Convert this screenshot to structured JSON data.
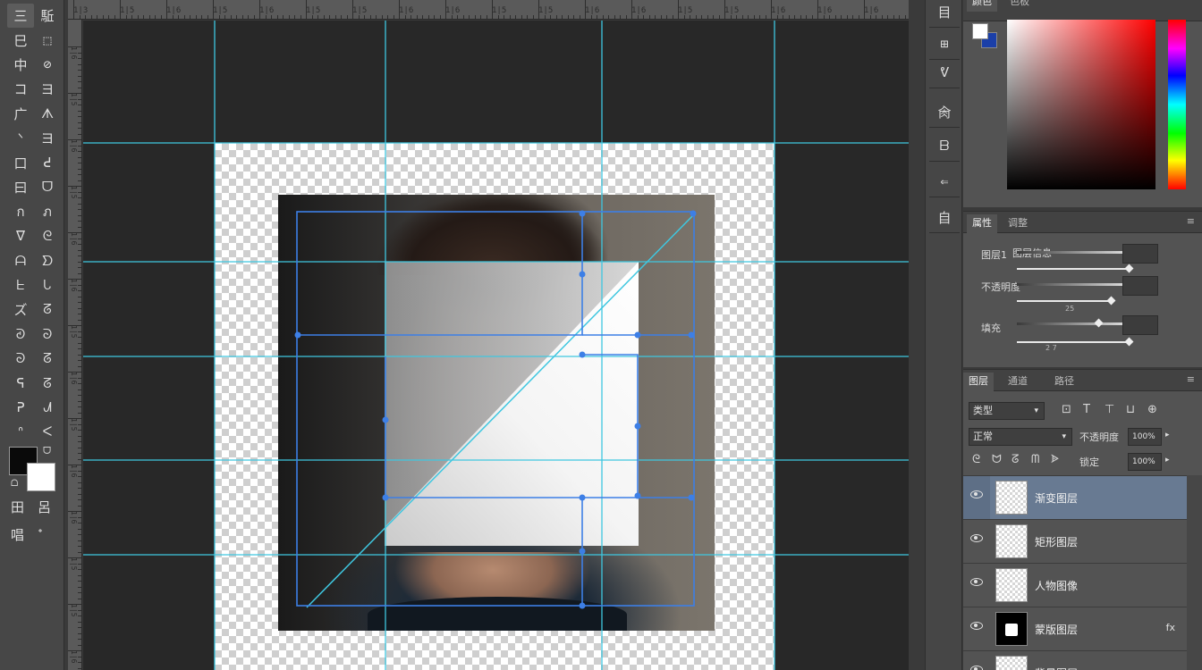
{
  "toolbar": {
    "tools": [
      {
        "glyph": "三",
        "icon": "move-icon"
      },
      {
        "glyph": "駈",
        "icon": "artboard-icon"
      },
      {
        "glyph": "巳",
        "icon": "marquee-icon"
      },
      {
        "glyph": "⬚",
        "icon": "lasso-icon"
      },
      {
        "glyph": "中",
        "icon": "quick-select-icon"
      },
      {
        "glyph": "⊘",
        "icon": "magic-wand-icon"
      },
      {
        "glyph": "コ",
        "icon": "crop-icon"
      },
      {
        "glyph": "ヨ",
        "icon": "slice-icon"
      },
      {
        "glyph": "广",
        "icon": "eyedropper-icon"
      },
      {
        "glyph": "ᗑ",
        "icon": "ruler-icon"
      },
      {
        "glyph": "ᐠ",
        "icon": "healing-icon"
      },
      {
        "glyph": "ヨ",
        "icon": "patch-icon"
      },
      {
        "glyph": "口",
        "icon": "brush-icon"
      },
      {
        "glyph": "ᕍ",
        "icon": "pencil-icon"
      },
      {
        "glyph": "曰",
        "icon": "stamp-icon"
      },
      {
        "glyph": "ᗜ",
        "icon": "pattern-stamp-icon"
      },
      {
        "glyph": "ก",
        "icon": "history-brush-icon"
      },
      {
        "glyph": "ภ",
        "icon": "art-history-icon"
      },
      {
        "glyph": "ᐁ",
        "icon": "eraser-icon"
      },
      {
        "glyph": "ᘓ",
        "icon": "bg-eraser-icon"
      },
      {
        "glyph": "ᗩ",
        "icon": "gradient-icon"
      },
      {
        "glyph": "ᗤ",
        "icon": "paint-bucket-icon"
      },
      {
        "glyph": "ᖶ",
        "icon": "blur-icon"
      },
      {
        "glyph": "ᘂ",
        "icon": "sharpen-icon"
      },
      {
        "glyph": "ズ",
        "icon": "dodge-icon"
      },
      {
        "glyph": "ᘔ",
        "icon": "burn-icon"
      },
      {
        "glyph": "ᘑ",
        "icon": "pen-icon"
      },
      {
        "glyph": "ᘐ",
        "icon": "freeform-pen-icon"
      },
      {
        "glyph": "ᘐ",
        "icon": "type-icon"
      },
      {
        "glyph": "ᘔ",
        "icon": "vertical-type-icon"
      },
      {
        "glyph": "ᕋ",
        "icon": "path-select-icon"
      },
      {
        "glyph": "ᘔ",
        "icon": "direct-select-icon"
      },
      {
        "glyph": "ᕈ",
        "icon": "rectangle-icon"
      },
      {
        "glyph": "ᗂ",
        "icon": "ellipse-icon"
      },
      {
        "glyph": "ᐢ",
        "icon": "hand-icon"
      },
      {
        "glyph": "ᐸ",
        "icon": "zoom-icon"
      }
    ],
    "swap_glyph": "ᗜ",
    "reset_glyph": "ᗝ",
    "quickmask_a": "田",
    "quickmask_b": "呂",
    "screen_mode_a": "唱",
    "screen_mode_b": "ᐩ",
    "fg_color": "#0a0a0a",
    "bg_color": "#ffffff"
  },
  "rulers": {
    "top_labels": [
      "1|3",
      "1|5",
      "1|6",
      "1|5",
      "1|6",
      "1|5",
      "1|5",
      "1|6",
      "1|6",
      "1|5",
      "1|5",
      "1|6",
      "1|6",
      "1|5",
      "1|5",
      "1|6",
      "1|6",
      "1|6"
    ],
    "left_labels": [
      "1|6",
      "1|5",
      "1|6",
      "1|5",
      "1|6",
      "1|6",
      "1|5",
      "1|6",
      "1|5",
      "1|6",
      "1|6",
      "1|5",
      "1|5",
      "1|6"
    ]
  },
  "middle_column": {
    "icons": [
      "history-icon",
      "actions-icon",
      "brush-presets-icon",
      "swatches-icon",
      "properties-icon",
      "paths-icon",
      "libraries-icon"
    ],
    "glyphs": [
      "目",
      "⊞",
      "ᕓ",
      "肏",
      "ᗷ",
      "⇐",
      "自"
    ]
  },
  "color_panel": {
    "tabs": [
      "颜色",
      "色板"
    ],
    "fg_color": "#ffffff",
    "bg_color": "#1b3fa8"
  },
  "adjust_panel": {
    "tabs": [
      "属性",
      "调整"
    ],
    "rows": [
      {
        "label": "图层1",
        "label2": "图层信息",
        "small": ""
      },
      {
        "label": "不透明度",
        "label2": "",
        "small": "25"
      },
      {
        "label": "填充",
        "label2": "",
        "small": "2   7"
      }
    ],
    "close_glyph": "≡"
  },
  "layers_panel": {
    "tabs": [
      "图层",
      "通道",
      "路径"
    ],
    "filter_kind": "类型",
    "filter_icons": [
      "⊡",
      "T",
      "⊤",
      "⊔",
      "⊕"
    ],
    "blend_mode": "正常",
    "opacity_label": "不透明度",
    "opacity_value": "100%",
    "lock_label": "锁定",
    "lock_icons": [
      "ᘓ",
      "ᗢ",
      "ᘔ",
      "ᗰ",
      "ᗎ"
    ],
    "fill_label": "填充",
    "fill_value": "100%",
    "close_glyph": "≡",
    "layers": [
      {
        "name": "渐变图层",
        "fx": "",
        "thumb": "transparent",
        "selected": true
      },
      {
        "name": "矩形图层",
        "fx": "",
        "thumb": "transparent",
        "selected": false
      },
      {
        "name": "人物图像",
        "fx": "",
        "thumb": "transparent",
        "selected": false
      },
      {
        "name": "蒙版图层",
        "fx": "fx",
        "thumb": "dark",
        "selected": false
      },
      {
        "name": "背景图层",
        "fx": "",
        "thumb": "transparent",
        "selected": false
      }
    ]
  },
  "canvas": {
    "guide_color": "#3fc7e0",
    "path_color": "#3d7fe6",
    "pasteboard_color": "#282828"
  }
}
